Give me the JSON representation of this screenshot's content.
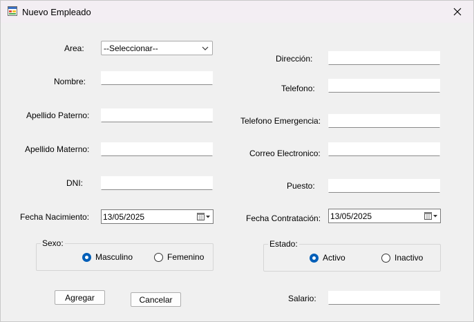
{
  "window": {
    "title": "Nuevo Empleado"
  },
  "left": {
    "area": {
      "label": "Area:",
      "value": "--Seleccionar--"
    },
    "nombre": {
      "label": "Nombre:",
      "value": ""
    },
    "apellido_paterno": {
      "label": "Apellido Paterno:",
      "value": ""
    },
    "apellido_materno": {
      "label": "Apellido Materno:",
      "value": ""
    },
    "dni": {
      "label": "DNI:",
      "value": ""
    },
    "fecha_nacimiento": {
      "label": "Fecha Nacimiento:",
      "value": "13/05/2025"
    }
  },
  "right": {
    "direccion": {
      "label": "Dirección:",
      "value": ""
    },
    "telefono": {
      "label": "Telefono:",
      "value": ""
    },
    "telefono_emergencia": {
      "label": "Telefono Emergencia:",
      "value": ""
    },
    "correo": {
      "label": "Correo Electronico:",
      "value": ""
    },
    "puesto": {
      "label": "Puesto:",
      "value": ""
    },
    "fecha_contratacion": {
      "label": "Fecha Contratación:",
      "value": "13/05/2025"
    },
    "salario": {
      "label": "Salario:",
      "value": ""
    }
  },
  "sexo": {
    "legend": "Sexo:",
    "options": [
      "Masculino",
      "Femenino"
    ],
    "selected": "Masculino"
  },
  "estado": {
    "legend": "Estado:",
    "options": [
      "Activo",
      "Inactivo"
    ],
    "selected": "Activo"
  },
  "buttons": {
    "agregar": "Agregar",
    "cancelar": "Cancelar"
  },
  "colors": {
    "accent": "#005fb8",
    "titlebar": "#f3eef3",
    "background": "#f0f0f0"
  },
  "icons": {
    "app": "app-form-icon",
    "close": "close-icon",
    "dropdown": "chevron-down-icon",
    "calendar": "calendar-icon"
  }
}
